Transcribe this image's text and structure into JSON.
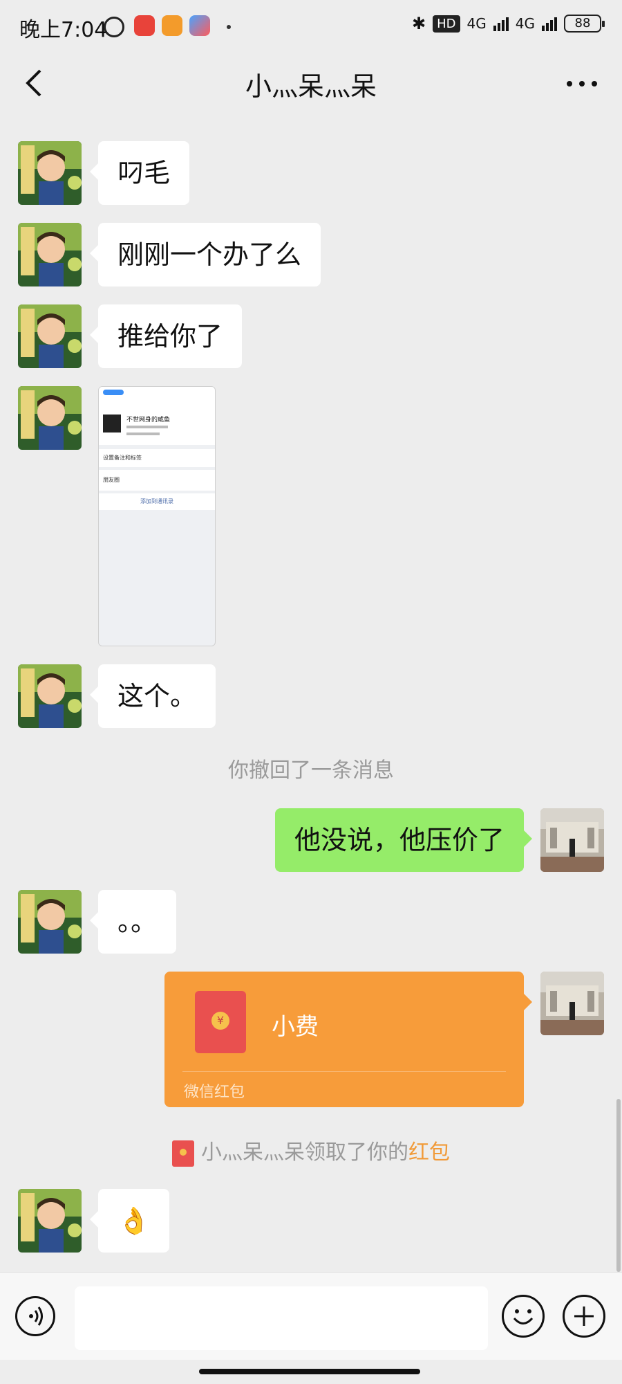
{
  "status_bar": {
    "time": "晚上7:04",
    "network_1": "4G",
    "network_2": "4G",
    "hd_badge": "HD",
    "battery": "88"
  },
  "header": {
    "title": "小灬呆灬呆"
  },
  "messages": [
    {
      "side": "left",
      "text": "叼毛"
    },
    {
      "side": "left",
      "text": "刚刚一个办了么"
    },
    {
      "side": "left",
      "text": "推给你了"
    },
    {
      "side": "left",
      "type": "image"
    },
    {
      "side": "left",
      "text": "这个。"
    },
    {
      "side": "system",
      "text": "你撤回了一条消息"
    },
    {
      "side": "right",
      "text": "他没说，他压价了"
    },
    {
      "side": "left",
      "text": "。。"
    },
    {
      "side": "right",
      "type": "red_packet"
    },
    {
      "side": "system",
      "type": "red_packet_notice"
    },
    {
      "side": "left",
      "text": "👌"
    }
  ],
  "screenshot_image": {
    "name": "不世网身的咸鱼",
    "row1": "设置备注和标签",
    "row2": "朋友圈",
    "row3": "添加到通讯录"
  },
  "red_packet": {
    "title": "小费",
    "label": "微信红包"
  },
  "notice": {
    "prefix": "小灬呆灬呆领取了你的",
    "highlight": "红包"
  },
  "recall_note": "你撤回了一条消息",
  "input": {
    "placeholder": ""
  },
  "colors": {
    "bubble_right": "#95ec69",
    "red_packet": "#f79c3a",
    "highlight": "#f19a38"
  }
}
